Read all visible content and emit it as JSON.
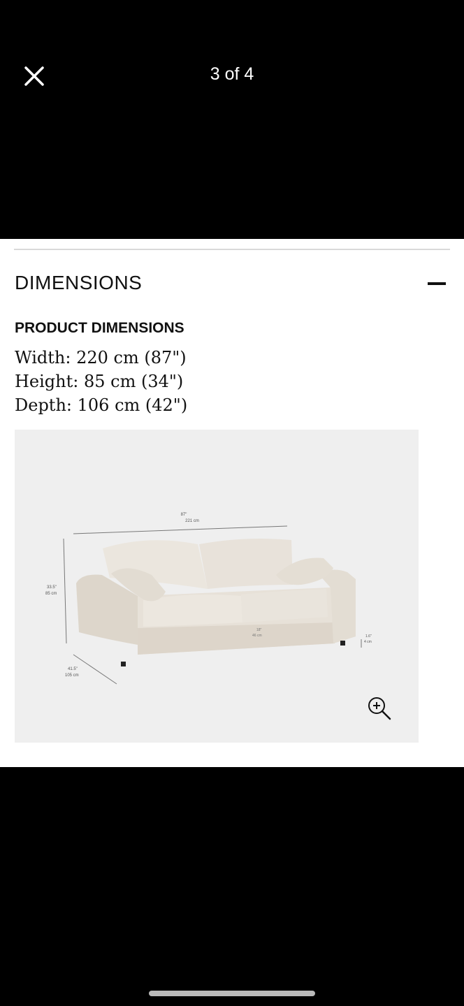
{
  "header": {
    "close_icon": "close-icon",
    "counter": "3 of 4"
  },
  "section": {
    "title": "DIMENSIONS",
    "collapse_icon": "minus-icon"
  },
  "product_dimensions": {
    "heading": "PRODUCT DIMENSIONS",
    "lines": [
      "Width: 220 cm (87\")",
      "Height: 85 cm (34\")",
      "Depth: 106 cm (42\")"
    ]
  },
  "diagram": {
    "width_label": [
      "87\"",
      "221 cm"
    ],
    "height_label": [
      "33.5\"",
      "85 cm"
    ],
    "depth_label": [
      "41.5\"",
      "105 cm"
    ],
    "seat_label": [
      "18\"",
      "46 cm"
    ],
    "leg_label": [
      "1.6\"",
      "4 cm"
    ],
    "zoom_icon": "zoom-in-icon"
  }
}
